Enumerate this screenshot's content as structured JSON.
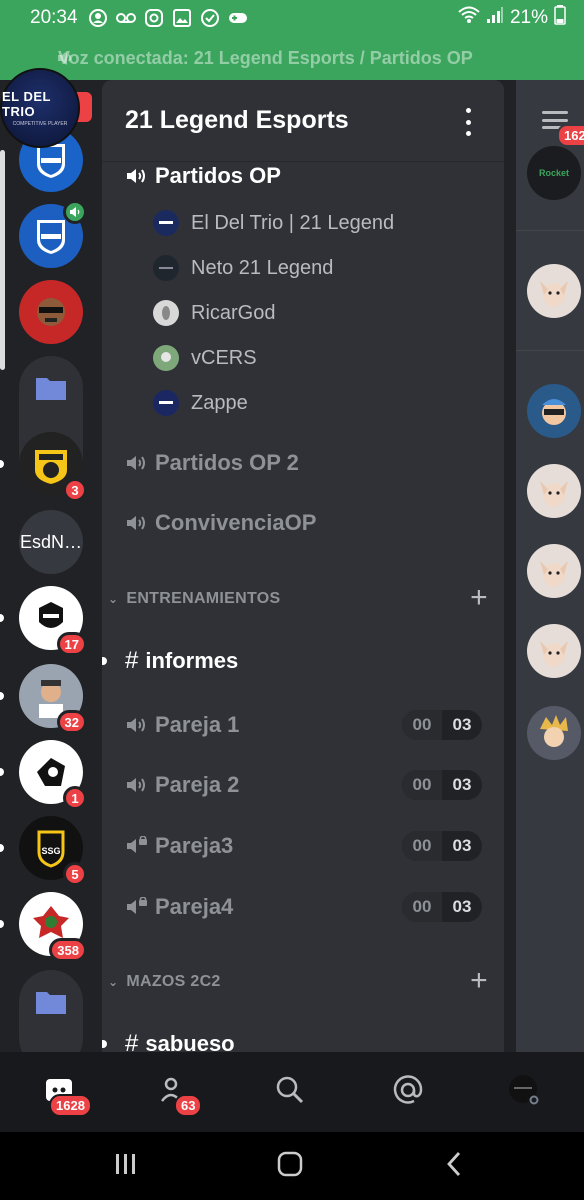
{
  "status_bar": {
    "time": "20:34",
    "battery": "21%",
    "icons": [
      "user-circle-icon",
      "voicemail-icon",
      "instagram-icon",
      "gallery-icon",
      "check-circle-icon",
      "gamepad-icon"
    ]
  },
  "voice_bar": {
    "text": "Voz conectada: 21 Legend Esports / Partidos OP"
  },
  "rail": {
    "active_server_line1": "EL DEL TRIO",
    "active_server_line2": "COMPETITIVE PLAYER",
    "esd_label": "EsdN…",
    "badges": [
      "3",
      "17",
      "32",
      "1",
      "5",
      "358"
    ]
  },
  "server": {
    "name": "21 Legend Esports"
  },
  "channels": {
    "voice_active": {
      "name": "Partidos OP"
    },
    "members": [
      {
        "name": "El Del Trio | 21 Legend"
      },
      {
        "name": "Neto 21 Legend"
      },
      {
        "name": "RicarGod"
      },
      {
        "name": "vCERS"
      },
      {
        "name": "Zappe"
      }
    ],
    "voice_2": {
      "name": "Partidos OP 2"
    },
    "voice_3": {
      "name": "ConvivenciaOP"
    },
    "category_1": {
      "name": "ENTRENAMIENTOS"
    },
    "text_1": {
      "name": "informes"
    },
    "pareja": [
      {
        "name": "Pareja 1",
        "left": "00",
        "right": "03"
      },
      {
        "name": "Pareja 2",
        "left": "00",
        "right": "03"
      },
      {
        "name": "Pareja3",
        "left": "00",
        "right": "03"
      },
      {
        "name": "Pareja4",
        "left": "00",
        "right": "03"
      }
    ],
    "category_2": {
      "name": "MAZOS 2C2"
    },
    "text_2": {
      "name": "sabueso"
    }
  },
  "member_strip": {
    "count": "162"
  },
  "bottom_nav": {
    "home_badge": "1628",
    "friends_badge": "63"
  },
  "colors": {
    "green": "#3ba55d",
    "red": "#ed4245",
    "panel": "#2f3136",
    "rail": "#202225"
  }
}
